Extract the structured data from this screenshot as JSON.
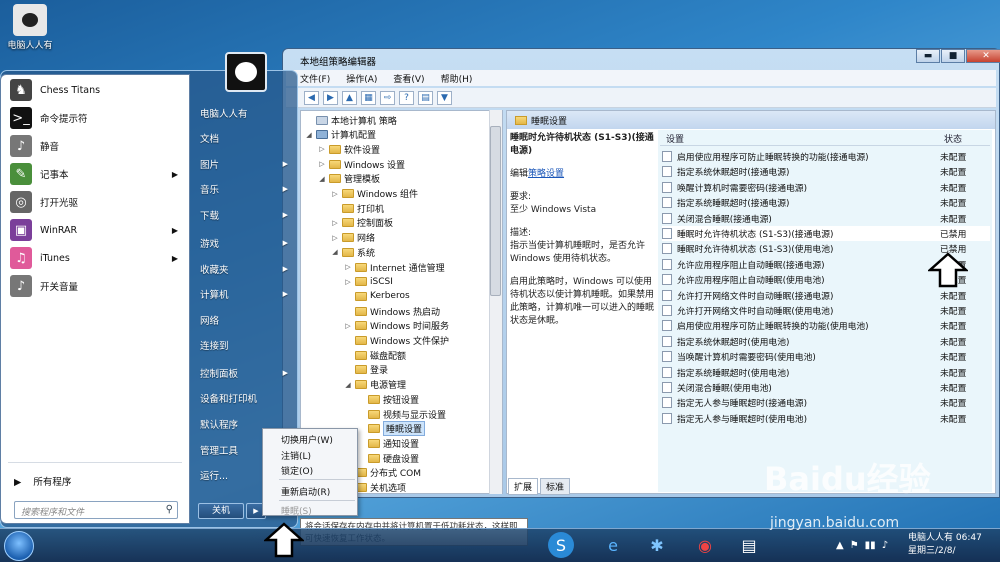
{
  "desktop": {
    "icon_label": "电脑人人有"
  },
  "start_menu": {
    "programs": [
      {
        "label": "Chess Titans",
        "icon": "chess-icon",
        "arrow": false
      },
      {
        "label": "命令提示符",
        "icon": "cmd-icon",
        "arrow": false
      },
      {
        "label": "静音",
        "icon": "speaker-icon",
        "arrow": false
      },
      {
        "label": "记事本",
        "icon": "notepad-icon",
        "arrow": true
      },
      {
        "label": "打开光驱",
        "icon": "cdrom-icon",
        "arrow": false
      },
      {
        "label": "WinRAR",
        "icon": "winrar-icon",
        "arrow": true
      },
      {
        "label": "iTunes",
        "icon": "itunes-icon",
        "arrow": true
      },
      {
        "label": "开关音量",
        "icon": "volume-icon",
        "arrow": false
      }
    ],
    "all_programs": "所有程序",
    "search_placeholder": "搜索程序和文件",
    "right_items": [
      {
        "label": "电脑人人有",
        "arrow": false
      },
      {
        "label": "文档",
        "arrow": false
      },
      {
        "label": "图片",
        "arrow": true
      },
      {
        "label": "音乐",
        "arrow": true
      },
      {
        "label": "下载",
        "arrow": true
      },
      {
        "label": "游戏",
        "arrow": true
      },
      {
        "label": "收藏夹",
        "arrow": true
      },
      {
        "label": "计算机",
        "arrow": true
      },
      {
        "label": "网络",
        "arrow": false
      },
      {
        "label": "连接到",
        "arrow": false
      },
      {
        "label": "控制面板",
        "arrow": true
      },
      {
        "label": "设备和打印机",
        "arrow": false
      },
      {
        "label": "默认程序",
        "arrow": false
      },
      {
        "label": "管理工具",
        "arrow": true
      },
      {
        "label": "运行...",
        "arrow": false
      }
    ],
    "shutdown_label": "关机",
    "shutdown_arrow": "▶"
  },
  "power_menu": {
    "items": [
      "切换用户(W)",
      "注销(L)",
      "锁定(O)",
      "重新启动(R)",
      "睡眠(S)"
    ],
    "tooltip": "将会话保存在内存中并将计算机置于低功耗状态，这样即可快速恢复工作状态。"
  },
  "window": {
    "title": "本地组策略编辑器",
    "menu": [
      "文件(F)",
      "操作(A)",
      "查看(V)",
      "帮助(H)"
    ],
    "controls": {
      "minimize": "▬",
      "maximize": "■",
      "close": "✕"
    },
    "tree": [
      {
        "label": "本地计算机 策略",
        "depth": 0,
        "twist": "",
        "kind": "policy"
      },
      {
        "label": "计算机配置",
        "depth": 0,
        "twist": "◢",
        "kind": "computer"
      },
      {
        "label": "软件设置",
        "depth": 1,
        "twist": "▷",
        "kind": "folder"
      },
      {
        "label": "Windows 设置",
        "depth": 1,
        "twist": "▷",
        "kind": "folder"
      },
      {
        "label": "管理模板",
        "depth": 1,
        "twist": "◢",
        "kind": "folder"
      },
      {
        "label": "Windows 组件",
        "depth": 2,
        "twist": "▷",
        "kind": "folder"
      },
      {
        "label": "打印机",
        "depth": 2,
        "twist": "",
        "kind": "folder"
      },
      {
        "label": "控制面板",
        "depth": 2,
        "twist": "▷",
        "kind": "folder"
      },
      {
        "label": "网络",
        "depth": 2,
        "twist": "▷",
        "kind": "folder"
      },
      {
        "label": "系统",
        "depth": 2,
        "twist": "◢",
        "kind": "folder"
      },
      {
        "label": "Internet 通信管理",
        "depth": 3,
        "twist": "▷",
        "kind": "folder"
      },
      {
        "label": "iSCSI",
        "depth": 3,
        "twist": "▷",
        "kind": "folder"
      },
      {
        "label": "Kerberos",
        "depth": 3,
        "twist": "",
        "kind": "folder"
      },
      {
        "label": "Windows 热启动",
        "depth": 3,
        "twist": "",
        "kind": "folder"
      },
      {
        "label": "Windows 时间服务",
        "depth": 3,
        "twist": "▷",
        "kind": "folder"
      },
      {
        "label": "Windows 文件保护",
        "depth": 3,
        "twist": "",
        "kind": "folder"
      },
      {
        "label": "磁盘配额",
        "depth": 3,
        "twist": "",
        "kind": "folder"
      },
      {
        "label": "登录",
        "depth": 3,
        "twist": "",
        "kind": "folder"
      },
      {
        "label": "电源管理",
        "depth": 3,
        "twist": "◢",
        "kind": "folder"
      },
      {
        "label": "按钮设置",
        "depth": 4,
        "twist": "",
        "kind": "folder"
      },
      {
        "label": "视频与显示设置",
        "depth": 4,
        "twist": "",
        "kind": "folder"
      },
      {
        "label": "睡眠设置",
        "depth": 4,
        "twist": "",
        "kind": "folder",
        "selected": true
      },
      {
        "label": "通知设置",
        "depth": 4,
        "twist": "",
        "kind": "folder"
      },
      {
        "label": "硬盘设置",
        "depth": 4,
        "twist": "",
        "kind": "folder"
      },
      {
        "label": "分布式 COM",
        "depth": 3,
        "twist": "▷",
        "kind": "folder"
      },
      {
        "label": "关机选项",
        "depth": 3,
        "twist": "",
        "kind": "folder"
      }
    ],
    "pane_header": "睡眠设置",
    "desc": {
      "title": "睡眠时允许待机状态 (S1-S3)(接通电源)",
      "edit_prefix": "编辑",
      "edit_link": "策略设置",
      "req_label": "要求:",
      "req_value": "至少 Windows Vista",
      "desc_label": "描述:",
      "desc_text": "指示当使计算机睡眠时，是否允许 Windows 使用待机状态。",
      "desc_text2": "启用此策略时，Windows 可以使用待机状态以使计算机睡眠。如果禁用此策略，计算机唯一可以进入的睡眠状态是休眠。"
    },
    "columns": {
      "setting": "设置",
      "state": "状态"
    },
    "settings": [
      {
        "name": "启用使应用程序可防止睡眠转换的功能(接通电源)",
        "state": "未配置"
      },
      {
        "name": "指定系统休眠超时(接通电源)",
        "state": "未配置"
      },
      {
        "name": "唤醒计算机时需要密码(接通电源)",
        "state": "未配置"
      },
      {
        "name": "指定系统睡眠超时(接通电源)",
        "state": "未配置"
      },
      {
        "name": "关闭混合睡眠(接通电源)",
        "state": "未配置"
      },
      {
        "name": "睡眠时允许待机状态 (S1-S3)(接通电源)",
        "state": "已禁用"
      },
      {
        "name": "睡眠时允许待机状态 (S1-S3)(使用电池)",
        "state": "已禁用"
      },
      {
        "name": "允许应用程序阻止自动睡眠(接通电源)",
        "state": "未配置"
      },
      {
        "name": "允许应用程序阻止自动睡眠(使用电池)",
        "state": "未配置"
      },
      {
        "name": "允许打开网络文件时自动睡眠(接通电源)",
        "state": "未配置"
      },
      {
        "name": "允许打开网络文件时自动睡眠(使用电池)",
        "state": "未配置"
      },
      {
        "name": "启用使应用程序可防止睡眠转换的功能(使用电池)",
        "state": "未配置"
      },
      {
        "name": "指定系统休眠超时(使用电池)",
        "state": "未配置"
      },
      {
        "name": "当唤醒计算机时需要密码(使用电池)",
        "state": "未配置"
      },
      {
        "name": "指定系统睡眠超时(使用电池)",
        "state": "未配置"
      },
      {
        "name": "关闭混合睡眠(使用电池)",
        "state": "未配置"
      },
      {
        "name": "指定无人参与睡眠超时(接通电源)",
        "state": "未配置"
      },
      {
        "name": "指定无人参与睡眠超时(使用电池)",
        "state": "未配置"
      }
    ],
    "tabs": [
      "扩展",
      "标准"
    ]
  },
  "taskbar": {
    "clock_user": "电脑人人有 06:47",
    "clock_date": "星期三/2/8/",
    "tray": [
      "▲",
      "⚑",
      "▮▮",
      "♪"
    ],
    "apps": [
      "sogou-icon",
      "ie-icon",
      "settings-icon",
      "chrome-icon",
      "notepad-icon"
    ]
  },
  "watermark": {
    "text": "Baidu经验",
    "url": "jingyan.baidu.com"
  }
}
